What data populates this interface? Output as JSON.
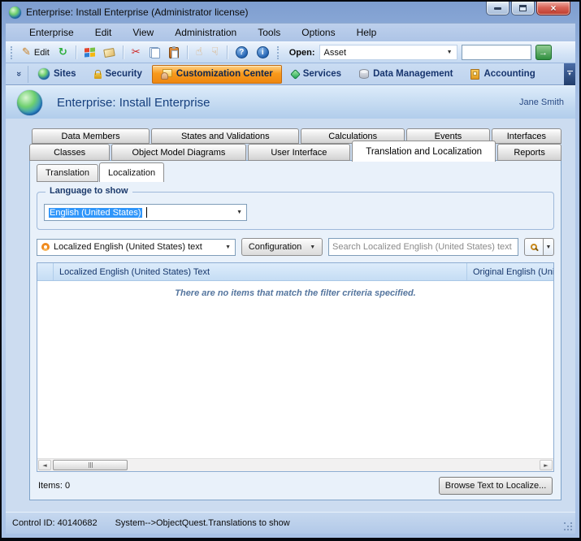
{
  "window": {
    "title": "Enterprise: Install Enterprise (Administrator license)"
  },
  "menu": {
    "items": [
      "Enterprise",
      "Edit",
      "View",
      "Administration",
      "Tools",
      "Options",
      "Help"
    ]
  },
  "toolbar": {
    "edit_label": "Edit",
    "open_label": "Open:",
    "open_value": "Asset",
    "quick_value": ""
  },
  "nav": {
    "items": [
      "Sites",
      "Security",
      "Customization Center",
      "Services",
      "Data Management",
      "Accounting"
    ],
    "active": "Customization Center"
  },
  "header": {
    "title": "Enterprise: Install Enterprise",
    "user": "Jane Smith"
  },
  "tabs": {
    "row1": [
      "Data Members",
      "States and Validations",
      "Calculations",
      "Events",
      "Interfaces"
    ],
    "row2": [
      "Classes",
      "Object Model Diagrams",
      "User Interface",
      "Translation and Localization",
      "Reports"
    ],
    "selected": "Translation and Localization"
  },
  "subtabs": {
    "items": [
      "Translation",
      "Localization"
    ],
    "selected": "Localization"
  },
  "language_group": {
    "label": "Language to show",
    "value": "English (United States)"
  },
  "filter": {
    "field_selector": "Localized English (United States) text",
    "configuration_label": "Configuration",
    "search_placeholder": "Search Localized English (United States) text  (C"
  },
  "table": {
    "columns": [
      "",
      "Localized English (United States) Text",
      "Original English (United"
    ],
    "empty_message": "There are no items that match the filter criteria specified."
  },
  "footer": {
    "items_label": "Items: 0",
    "browse_button": "Browse Text to Localize..."
  },
  "statusbar": {
    "control_id": "Control ID: 40140682",
    "path": "System-->ObjectQuest.Translations to show"
  },
  "icons": {
    "refresh": "↻",
    "cut": "✂",
    "edit_pencil": "✎",
    "thumb_up": "☝",
    "thumb_down": "☟",
    "help": "?",
    "info": "i",
    "go_arrow": "→",
    "dropdown_arrow": "▼",
    "chevron_double": "»",
    "overflow_down": "▾",
    "scroll_left": "◄",
    "scroll_right": "►",
    "close": "×"
  },
  "colors": {
    "nav_active_orange": "#f89a1c",
    "selection_blue": "#3096fa",
    "titlebar_blue": "#8fafd9",
    "header_text_blue": "#16407e",
    "status_blue": "#b7cde9"
  }
}
